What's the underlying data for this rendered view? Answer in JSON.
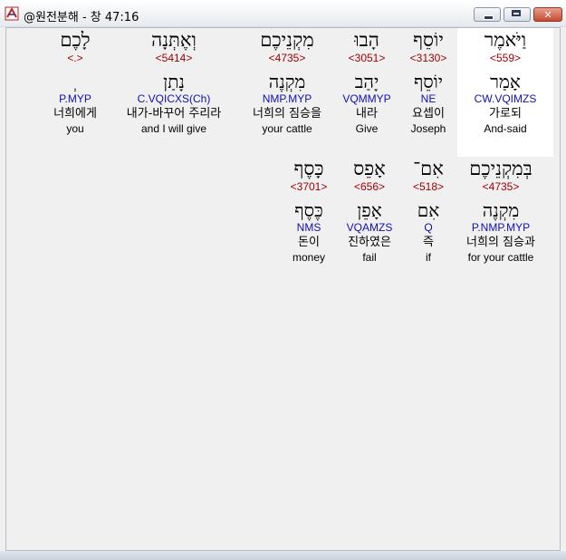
{
  "window": {
    "title": "@원전분해 - 창 47:16",
    "minimize_label": "",
    "maximize_label": "",
    "close_label": "✕"
  },
  "rows": [
    {
      "words": [
        {
          "hebrew": "וַיֹּאמֶר",
          "strong": "<559>",
          "lemma": "אָמַר",
          "parse": "CW.VQIMZS",
          "korean": "가로되",
          "english": "And-said",
          "highlight": true
        },
        {
          "hebrew": "יוֹסֵף",
          "strong": "<3130>",
          "lemma": "יוֹסֵף",
          "parse": "NE",
          "korean": "요셉이",
          "english": "Joseph",
          "highlight": false
        },
        {
          "hebrew": "הָבוּ",
          "strong": "<3051>",
          "lemma": "יָהַב",
          "parse": "VQMMYP",
          "korean": "내라",
          "english": "Give",
          "highlight": false
        },
        {
          "hebrew": "מִקְנֵיכֶם",
          "strong": "<4735>",
          "lemma": "מִקְנֶה",
          "parse": "NMP.MYP",
          "korean": "너희의 짐승을",
          "english": "your cattle",
          "highlight": false
        },
        {
          "hebrew": "וְאֶתְּנָה",
          "strong": "<5414>",
          "lemma": "נָתַן",
          "parse": "C.VQICXS(Ch)",
          "korean": "내가-바꾸어 주리라",
          "english": "and I will give",
          "highlight": false
        },
        {
          "hebrew": "לָכֶם",
          "strong": "<.>",
          "lemma": "ְ",
          "parse": "P.MYP",
          "korean": "너희에게",
          "english": "you",
          "highlight": false
        }
      ]
    },
    {
      "words": [
        {
          "hebrew": "בְּמִקְנֵיכֶם",
          "strong": "<4735>",
          "lemma": "מִקְנֶה",
          "parse": "P.NMP.MYP",
          "korean": "너희의 짐승과",
          "english": "for your cattle",
          "highlight": false
        },
        {
          "hebrew": "אִם־",
          "strong": "<518>",
          "lemma": "אִם",
          "parse": "Q",
          "korean": "즉",
          "english": "if",
          "highlight": false
        },
        {
          "hebrew": "אָפֵס",
          "strong": "<656>",
          "lemma": "אָפֵן",
          "parse": "VQAMZS",
          "korean": "진하였은",
          "english": "fail",
          "highlight": false
        },
        {
          "hebrew": "כָּסֶף",
          "strong": "<3701>",
          "lemma": "כֶּסֶף",
          "parse": "NMS",
          "korean": "돈이",
          "english": "money",
          "highlight": false
        }
      ]
    }
  ]
}
